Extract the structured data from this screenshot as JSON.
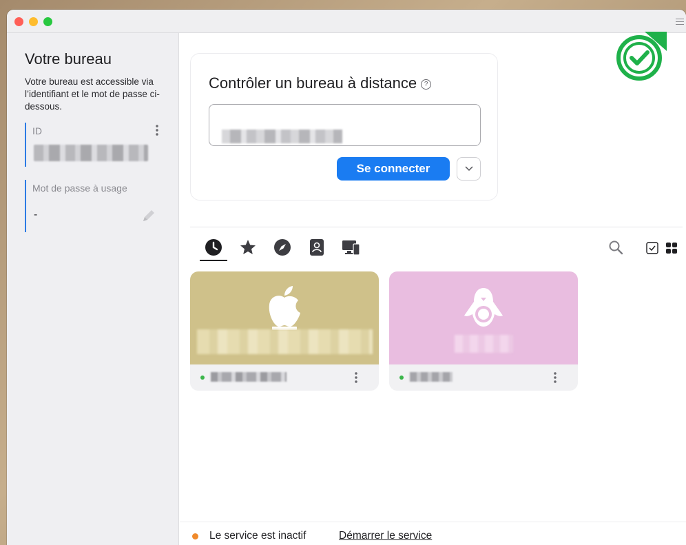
{
  "sidebar": {
    "title": "Votre bureau",
    "description": "Votre bureau est accessible via l’identifiant et le mot de passe ci-dessous.",
    "id_label": "ID",
    "password_label": "Mot de passe à usage",
    "password_value": "-"
  },
  "main": {
    "connect_card": {
      "title": "Contrôler un bureau à distance",
      "help_glyph": "?",
      "id_input_value": "",
      "connect_button": "Se connecter"
    },
    "tabs": [
      {
        "name": "recent",
        "icon": "clock-icon"
      },
      {
        "name": "favorites",
        "icon": "star-icon"
      },
      {
        "name": "discovered",
        "icon": "compass-icon"
      },
      {
        "name": "address-book",
        "icon": "contact-book-icon"
      },
      {
        "name": "group",
        "icon": "devices-icon"
      }
    ],
    "peers": [
      {
        "os": "macOS",
        "icon": "apple-icon",
        "color": "#cfc18a",
        "online": true
      },
      {
        "os": "Linux",
        "icon": "linux-penguin-icon",
        "color": "#e9bde0",
        "online": true
      }
    ]
  },
  "statusbar": {
    "status_text": "Le service est inactif",
    "start_link": "Démarrer le service",
    "status_color": "#f08a2c"
  },
  "colors": {
    "accent": "#1a7cf2",
    "online": "#3bb54a",
    "badge": "#1fb14a"
  }
}
